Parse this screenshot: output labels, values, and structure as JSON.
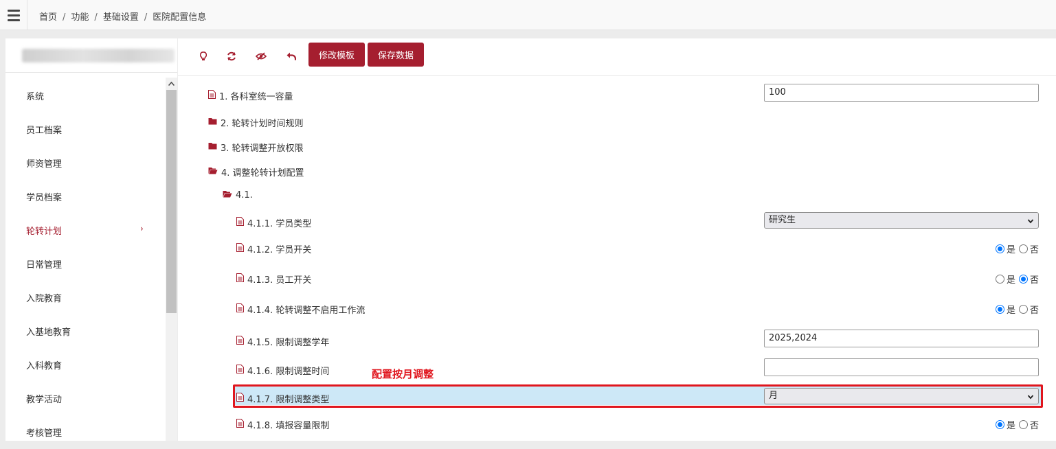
{
  "breadcrumb": {
    "home": "首页",
    "features": "功能",
    "basic": "基础设置",
    "current": "医院配置信息",
    "sep": "/"
  },
  "sidebar": {
    "items": [
      {
        "label": "系统"
      },
      {
        "label": "员工档案"
      },
      {
        "label": "师资管理"
      },
      {
        "label": "学员档案"
      },
      {
        "label": "轮转计划",
        "arrow": "›"
      },
      {
        "label": "日常管理"
      },
      {
        "label": "入院教育"
      },
      {
        "label": "入基地教育"
      },
      {
        "label": "入科教育"
      },
      {
        "label": "教学活动"
      },
      {
        "label": "考核管理"
      }
    ]
  },
  "toolbar": {
    "edit_template": "修改模板",
    "save_data": "保存数据"
  },
  "config": {
    "r1": {
      "label": "1. 各科室统一容量",
      "value": "100"
    },
    "r2": {
      "label": "2. 轮转计划时间规则"
    },
    "r3": {
      "label": "3. 轮转调整开放权限"
    },
    "r4": {
      "label": "4. 调整轮转计划配置"
    },
    "r41": {
      "label": "4.1."
    },
    "r411": {
      "label": "4.1.1. 学员类型",
      "selected": "研究生"
    },
    "r412": {
      "label": "4.1.2. 学员开关",
      "yes": "是",
      "no": "否",
      "value": "是"
    },
    "r413": {
      "label": "4.1.3. 员工开关",
      "yes": "是",
      "no": "否",
      "value": "否"
    },
    "r414": {
      "label": "4.1.4. 轮转调整不启用工作流",
      "yes": "是",
      "no": "否",
      "value": "是"
    },
    "r415": {
      "label": "4.1.5. 限制调整学年",
      "value": "2025,2024"
    },
    "r416": {
      "label": "4.1.6. 限制调整时间",
      "value": ""
    },
    "r417": {
      "label": "4.1.7. 限制调整类型",
      "selected": "月"
    },
    "r418": {
      "label": "4.1.8. 填报容量限制",
      "yes": "是",
      "no": "否",
      "value": "是"
    }
  },
  "annotation": {
    "text": "配置按月调整"
  },
  "colors": {
    "accent": "#a51e2f",
    "annotation": "#e0161e",
    "highlight": "#cde8f7",
    "radio": "#0075ff"
  }
}
